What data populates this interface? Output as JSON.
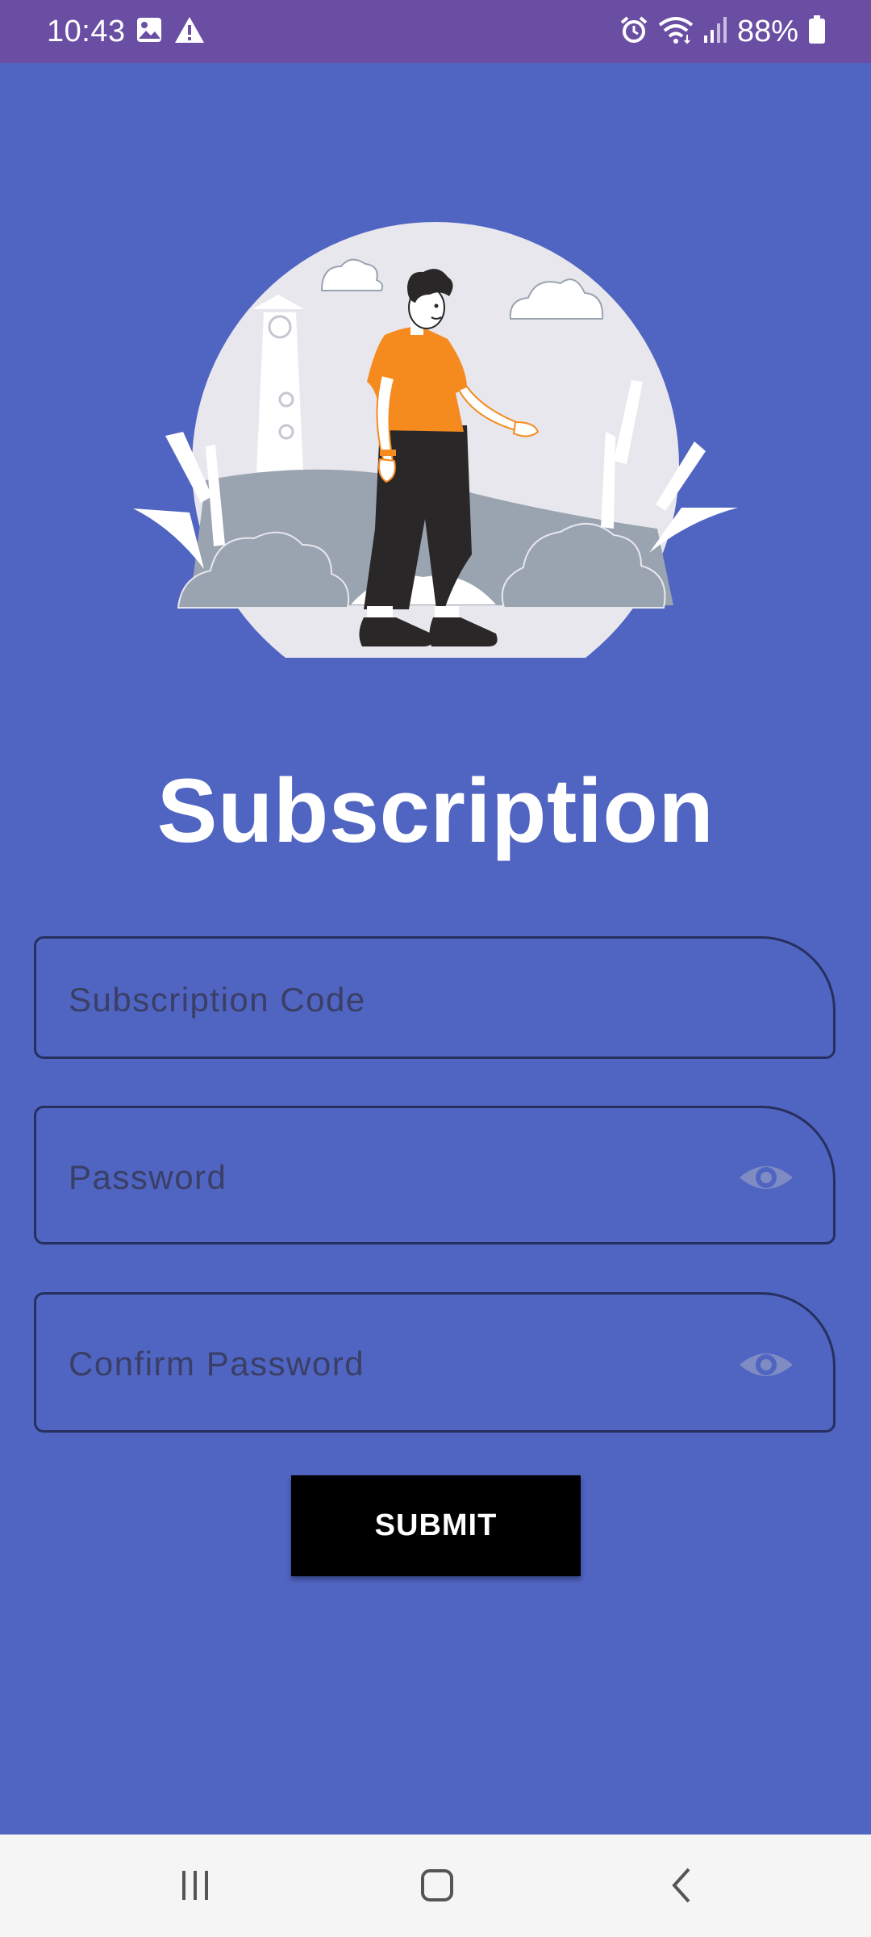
{
  "status_bar": {
    "time": "10:43",
    "battery": "88%",
    "left_icons": [
      "image-icon",
      "warning-icon"
    ],
    "right_icons": [
      "alarm-icon",
      "wifi-icon",
      "signal-icon",
      "battery-icon"
    ]
  },
  "title": "Subscription",
  "form": {
    "subscription_code": {
      "value": "",
      "placeholder": "Subscription Code"
    },
    "password": {
      "value": "",
      "placeholder": "Password",
      "toggle_icon": "eye-icon"
    },
    "confirm_password": {
      "value": "",
      "placeholder": "Confirm Password",
      "toggle_icon": "eye-icon"
    },
    "submit_label": "SUBMIT"
  },
  "nav_bar": {
    "buttons": [
      "recents-icon",
      "home-icon",
      "back-icon"
    ]
  },
  "colors": {
    "background": "#5064c2",
    "status_bar": "#6a4ea3",
    "button": "#000000",
    "field_border": "#26305e",
    "accent_orange": "#f58a1f"
  }
}
